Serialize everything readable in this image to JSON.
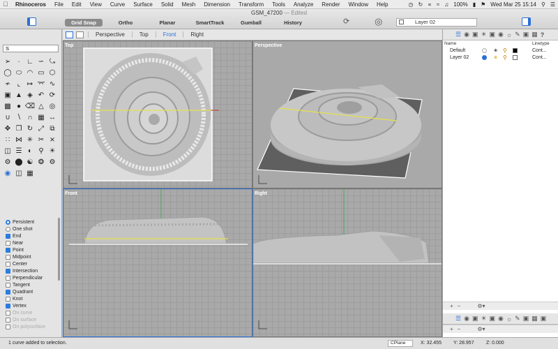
{
  "menubar": {
    "apple": "",
    "items": [
      "Rhinoceros",
      "File",
      "Edit",
      "View",
      "Curve",
      "Surface",
      "Solid",
      "Mesh",
      "Dimension",
      "Transform",
      "Tools",
      "Analyze",
      "Render",
      "Window",
      "Help"
    ],
    "battery": "100%",
    "datetime": "Wed Mar 25  15:14"
  },
  "window": {
    "title": "GSM_47200",
    "edited": "— Edited"
  },
  "toolbar": {
    "grid_snap": "Grid Snap",
    "ortho": "Ortho",
    "planar": "Planar",
    "smarttrack": "SmartTrack",
    "gumball": "Gumball",
    "history": "History",
    "current_layer": "Layer 02"
  },
  "view_tabs": [
    "Perspective",
    "Top",
    "Front",
    "Right"
  ],
  "active_view_tab": "Front",
  "command": {
    "value": "S"
  },
  "viewports": {
    "top": "Top",
    "perspective": "Perspective",
    "front": "Front",
    "right": "Right"
  },
  "osnap": {
    "persistent": "Persistent",
    "one_shot": "One shot",
    "items": [
      {
        "label": "End",
        "checked": true,
        "enabled": true
      },
      {
        "label": "Near",
        "checked": false,
        "enabled": true
      },
      {
        "label": "Point",
        "checked": true,
        "enabled": true
      },
      {
        "label": "Midpoint",
        "checked": false,
        "enabled": true
      },
      {
        "label": "Center",
        "checked": false,
        "enabled": true
      },
      {
        "label": "Intersection",
        "checked": true,
        "enabled": true
      },
      {
        "label": "Perpendicular",
        "checked": false,
        "enabled": true
      },
      {
        "label": "Tangent",
        "checked": false,
        "enabled": true
      },
      {
        "label": "Quadrant",
        "checked": true,
        "enabled": true
      },
      {
        "label": "Knot",
        "checked": false,
        "enabled": true
      },
      {
        "label": "Vertex",
        "checked": true,
        "enabled": true
      },
      {
        "label": "On curve",
        "checked": false,
        "enabled": false
      },
      {
        "label": "On surface",
        "checked": false,
        "enabled": false
      },
      {
        "label": "On polysurface",
        "checked": false,
        "enabled": false
      }
    ]
  },
  "layers": {
    "col_name": "Name",
    "col_linetype": "Linetype",
    "rows": [
      {
        "name": "Default",
        "linetype": "Cont...",
        "color": "#000000"
      },
      {
        "name": "Layer 02",
        "linetype": "Cont...",
        "color": "#ffffff"
      }
    ]
  },
  "status": {
    "message": "1 curve added to selection.",
    "cplane": "CPlane",
    "x": "X: 32.455",
    "y": "Y: 28.957",
    "z": "Z: 0.000"
  },
  "colors": {
    "accent": "#2a6fd6",
    "model": "#c9c9c9",
    "section_line": "#e6e24a",
    "axis_green": "#3fae4a",
    "axis_red": "#c0392b"
  }
}
